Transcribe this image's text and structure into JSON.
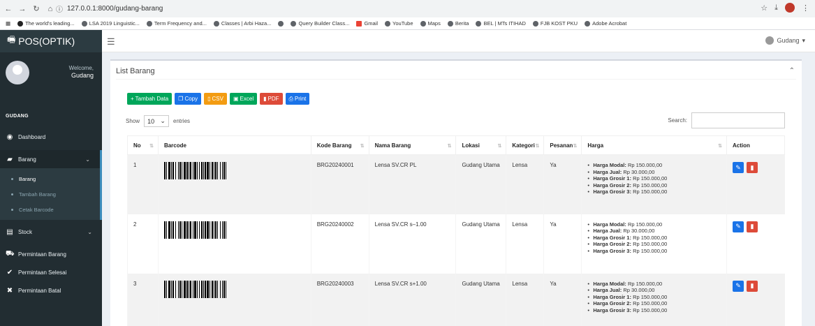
{
  "browser": {
    "url": "127.0.0.1:8000/gudang-barang",
    "bookmarks": [
      "The world's leading...",
      "LSA 2019 Linguistic...",
      "Term Frequency and...",
      "Classes | Arbi Haza...",
      "",
      "Query Builder Class...",
      "Gmail",
      "YouTube",
      "Maps",
      "Berita",
      "BEL | MTs ITIHAD",
      "FJB KOST PKU",
      "Adobe Acrobat"
    ]
  },
  "app": {
    "brand": "POS(OPTIK)",
    "user_menu": "Gudang",
    "welcome": "Welcome,",
    "user_name": "Gudang",
    "section": "GUDANG",
    "menu": {
      "dashboard": "Dashboard",
      "barang": "Barang",
      "sub": [
        "Barang",
        "Tambah Barang",
        "Cetak Barcode"
      ],
      "stock": "Stock",
      "permintaan_barang": "Permintaan Barang",
      "permintaan_selesai": "Permintaan Selesai",
      "permintaan_batal": "Permintaan Batal"
    }
  },
  "content": {
    "title": "List Barang",
    "buttons": {
      "tambah": "Tambah Data",
      "copy": "Copy",
      "csv": "CSV",
      "excel": "Excel",
      "pdf": "PDF",
      "print": "Print"
    },
    "show": "Show",
    "entries_value": "10",
    "entries": "entries",
    "search_label": "Search:",
    "columns": [
      "No",
      "Barcode",
      "Kode Barang",
      "Nama Barang",
      "Lokasi",
      "Kategori",
      "Pesanan",
      "Harga",
      "Action"
    ],
    "rows": [
      {
        "no": "1",
        "kode": "BRG20240001",
        "nama": "Lensa SV.CR PL",
        "lokasi": "Gudang Utama",
        "kategori": "Lensa",
        "pesanan": "Ya"
      },
      {
        "no": "2",
        "kode": "BRG20240002",
        "nama": "Lensa SV.CR s–1.00",
        "lokasi": "Gudang Utama",
        "kategori": "Lensa",
        "pesanan": "Ya"
      },
      {
        "no": "3",
        "kode": "BRG20240003",
        "nama": "Lensa SV.CR s+1.00",
        "lokasi": "Gudang Utama",
        "kategori": "Lensa",
        "pesanan": "Ya"
      }
    ],
    "harga_labels": [
      "Harga Modal:",
      "Harga Jual:",
      "Harga Grosir 1:",
      "Harga Grosir 2:",
      "Harga Grosir 3:"
    ],
    "harga_values": [
      "Rp 150.000,00",
      "Rp 30.000,00",
      "Rp 150.000,00",
      "Rp 150.000,00",
      "Rp 150.000,00"
    ]
  }
}
